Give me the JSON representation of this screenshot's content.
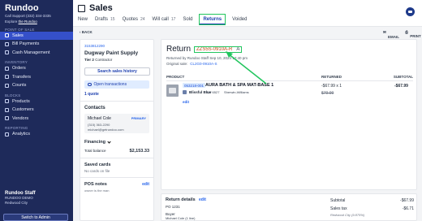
{
  "sidebar": {
    "brand": "Rundoo",
    "support": "Call Support (332) 334-3335",
    "explore_prefix": "Explore",
    "explore_link": "the Rundoo",
    "sections": {
      "pos": "POINT OF SALE",
      "inventory": "INVENTORY",
      "blocks": "BLOCKS",
      "reporting": "REPORTING"
    },
    "items": {
      "sales": "Sales",
      "bill_payments": "Bill Payments",
      "cash_management": "Cash Management",
      "orders": "Orders",
      "transfers": "Transfers",
      "counts": "Counts",
      "products": "Products",
      "customers": "Customers",
      "vendors": "Vendors",
      "analytics": "Analytics"
    },
    "staff_name": "Rundoo Staff",
    "staff_org": "RUNDOO DEMO",
    "staff_city": "Redwood City",
    "switch_admin": "Switch to Admin"
  },
  "header": {
    "title": "Sales",
    "tabs": [
      {
        "label": "New",
        "count": ""
      },
      {
        "label": "Drafts",
        "count": "15"
      },
      {
        "label": "Quotes",
        "count": "24"
      },
      {
        "label": "Will call",
        "count": "17"
      },
      {
        "label": "Sold",
        "count": ""
      },
      {
        "label": "Returns",
        "count": ""
      },
      {
        "label": "Voided",
        "count": ""
      }
    ],
    "back": "BACK",
    "email": "EMAIL",
    "print": "PRINT"
  },
  "customer": {
    "id": "3153812290",
    "name": "Dugway Paint Supply",
    "tier_label": "Tier 2",
    "tier_type": "Contractor",
    "history_button": "Search sales history",
    "open_transactions": "Open transactions",
    "quote": "1 quote",
    "contacts_heading": "Contacts",
    "contact_name": "Michael Cole",
    "contact_badge": "PRIMARY",
    "contact_phone": "(315) 363-2290",
    "contact_email": "michael@getrundoo.com",
    "financing": "Financing",
    "total_balance_label": "Total balance",
    "total_balance": "$2,153.33",
    "saved_cards": "Saved cards",
    "saved_cards_sub": "No cards on file",
    "pos_notes": "POS notes",
    "pos_notes_edit": "edit",
    "pos_notes_sub": "owner is the man"
  },
  "return": {
    "title": "Return",
    "number": "ZZS5S-0910A-R",
    "letter": "A",
    "meta": "Returned by Rundoo Staff Sep 10, 2024 12:40 pm",
    "original_label": "Original sale:",
    "original_id": "CL2G0-0910A-S",
    "columns": {
      "product": "PRODUCT",
      "returned": "RETURNED",
      "subtotal": "SUBTOTAL"
    },
    "item": {
      "sku": "053218-001",
      "name": "AURA BATH & SPA MAT-BASE 1",
      "color_name": "Blissful Blue",
      "color_code": "SW 6527",
      "color_brand": "Sherwin-Williams",
      "edit": "edit",
      "returned": "-$67.99 x 1",
      "original_price": "$79.99",
      "subtotal": "-$67.99"
    }
  },
  "details": {
    "heading": "Return details",
    "edit": "edit",
    "po_label": "PO",
    "po_value": "1231",
    "buyer_label": "Buyer",
    "buyer_value": "Michael Cole (1 line)",
    "subtotal_label": "Subtotal",
    "subtotal": "-$67.99",
    "tax_label": "Sales tax",
    "tax": "-$6.71",
    "tax_note": "Redwood City (9.875%)"
  },
  "colors": {
    "sidebar_bg": "#1e2a5a",
    "active_nav": "#3550c9",
    "link": "#2563eb",
    "return_number": "#c2410c",
    "annotation": "#22c55e"
  }
}
